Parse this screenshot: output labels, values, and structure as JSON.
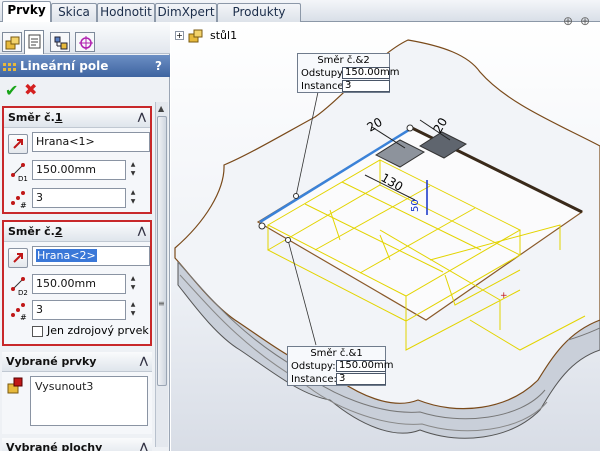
{
  "tabs": [
    "Prvky",
    "Skica",
    "Hodnotit",
    "DimXpert",
    "Produkty Office"
  ],
  "active_tab": "Prvky",
  "property_manager": {
    "title": "Lineární pole",
    "help": "?",
    "ok_symbol": "✔",
    "cancel_symbol": "✖",
    "direction1": {
      "header_prefix": "Směr č.",
      "header_num": "1",
      "edge": "Hrana<1>",
      "spacing": "150.00mm",
      "instances": "3",
      "dim_label": "D1"
    },
    "direction2": {
      "header_prefix": "Směr č.",
      "header_num": "2",
      "edge": "Hrana<2>",
      "spacing": "150.00mm",
      "instances": "3",
      "dim_label": "D2",
      "seed_only_label": "Jen zdrojový prvek"
    },
    "selected_features": {
      "header": "Vybrané prvky",
      "items": [
        "Vysunout3"
      ]
    },
    "selected_faces": {
      "header": "Vybrané plochy"
    }
  },
  "tree_label": "stůl1",
  "callout2": {
    "title": "Směr č.&2",
    "spacing_label": "Odstupy:",
    "spacing_value": "150.00mm",
    "instances_label": "Instance:",
    "instances_value": "3"
  },
  "callout1": {
    "title": "Směr č.&1",
    "spacing_label": "Odstupy:",
    "spacing_value": "150.00mm",
    "instances_label": "Instance:",
    "instances_value": "3"
  },
  "dimensions": [
    "20",
    "20",
    "130",
    "50"
  ]
}
